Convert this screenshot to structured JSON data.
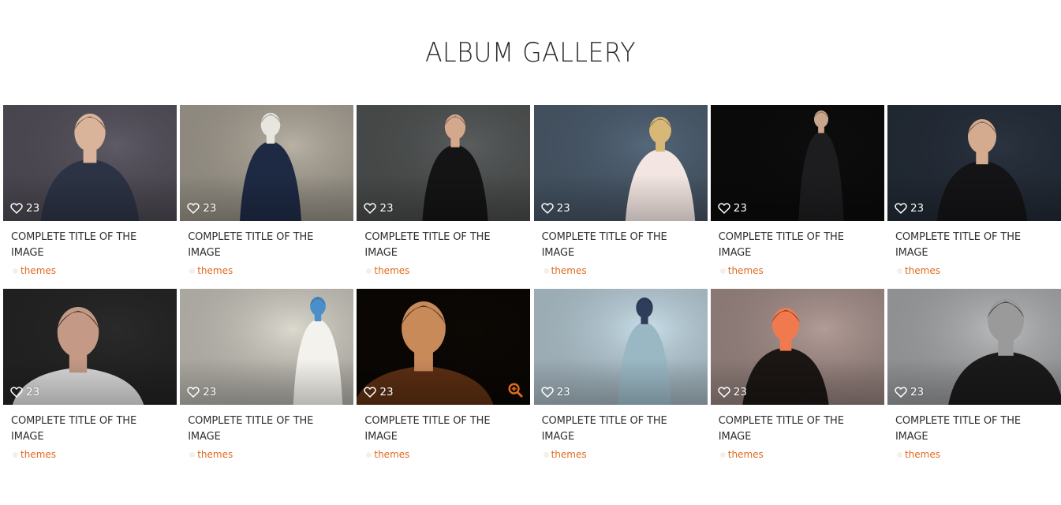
{
  "page": {
    "title": "ALBUM GALLERY"
  },
  "colors": {
    "accent": "#e06a1e",
    "title_text": "#2f2f2f",
    "heading_text": "#2b2b2b",
    "background": "#ffffff"
  },
  "gallery": {
    "items": [
      {
        "title": "COMPLETE TITLE OF THE IMAGE",
        "likes": "23",
        "tag": "themes",
        "like_icon": "heart-outline-icon",
        "photo": "man-in-grey-suit-adjusting-tie",
        "palette": [
          "#5e5a66",
          "#2c3344",
          "#d9b49b"
        ],
        "zoom_visible": false
      },
      {
        "title": "COMPLETE TITLE OF THE IMAGE",
        "likes": "23",
        "tag": "themes",
        "like_icon": "heart-outline-icon",
        "photo": "woman-in-striped-shirt-sitting",
        "palette": [
          "#b8b1a4",
          "#1e2a44",
          "#e8e4de"
        ],
        "zoom_visible": false
      },
      {
        "title": "COMPLETE TITLE OF THE IMAGE",
        "likes": "23",
        "tag": "themes",
        "like_icon": "heart-outline-icon",
        "photo": "man-in-black-suit",
        "palette": [
          "#5a5d5d",
          "#141414",
          "#d3a88c"
        ],
        "zoom_visible": false
      },
      {
        "title": "COMPLETE TITLE OF THE IMAGE",
        "likes": "23",
        "tag": "themes",
        "like_icon": "heart-outline-icon",
        "photo": "blonde-woman-white-blouse",
        "palette": [
          "#55677a",
          "#f3e6e2",
          "#d8b877"
        ],
        "zoom_visible": false
      },
      {
        "title": "COMPLETE TITLE OF THE IMAGE",
        "likes": "23",
        "tag": "themes",
        "like_icon": "heart-outline-icon",
        "photo": "man-in-pinstripe-suit",
        "palette": [
          "#0d0d0d",
          "#1d1d1f",
          "#c9a58c"
        ],
        "zoom_visible": false
      },
      {
        "title": "COMPLETE TITLE OF THE IMAGE",
        "likes": "23",
        "tag": "themes",
        "like_icon": "heart-outline-icon",
        "photo": "woman-in-fur-hood",
        "palette": [
          "#2a3340",
          "#141416",
          "#d4ab8f"
        ],
        "zoom_visible": false
      },
      {
        "title": "COMPLETE TITLE OF THE IMAGE",
        "likes": "23",
        "tag": "themes",
        "like_icon": "heart-outline-icon",
        "photo": "young-man-portrait",
        "palette": [
          "#2a2a2a",
          "#d8d8d8",
          "#c49a86"
        ],
        "zoom_visible": false
      },
      {
        "title": "COMPLETE TITLE OF THE IMAGE",
        "likes": "23",
        "tag": "themes",
        "like_icon": "heart-outline-icon",
        "photo": "redhead-woman-in-jeans",
        "palette": [
          "#dcd9cf",
          "#f4f2ec",
          "#4a8fc8"
        ],
        "zoom_visible": false
      },
      {
        "title": "COMPLETE TITLE OF THE IMAGE",
        "likes": "23",
        "tag": "themes",
        "like_icon": "heart-outline-icon",
        "photo": "curly-haired-woman-dark",
        "palette": [
          "#0c0804",
          "#5b2e12",
          "#c98a5a"
        ],
        "zoom_visible": true,
        "zoom_icon": "zoom-in-icon"
      },
      {
        "title": "COMPLETE TITLE OF THE IMAGE",
        "likes": "23",
        "tag": "themes",
        "like_icon": "heart-outline-icon",
        "photo": "woman-in-light-blue-shirt",
        "palette": [
          "#c9dfea",
          "#9ab7c4",
          "#2d3d5a"
        ],
        "zoom_visible": false
      },
      {
        "title": "COMPLETE TITLE OF THE IMAGE",
        "likes": "23",
        "tag": "themes",
        "like_icon": "heart-outline-icon",
        "photo": "woman-in-wide-brim-hat",
        "palette": [
          "#b39c97",
          "#1b1614",
          "#f07a4e"
        ],
        "zoom_visible": false
      },
      {
        "title": "COMPLETE TITLE OF THE IMAGE",
        "likes": "23",
        "tag": "themes",
        "like_icon": "heart-outline-icon",
        "photo": "woman-black-white-profile",
        "palette": [
          "#b9bbbd",
          "#1a1a1a",
          "#9a9a9a"
        ],
        "zoom_visible": false
      }
    ]
  }
}
